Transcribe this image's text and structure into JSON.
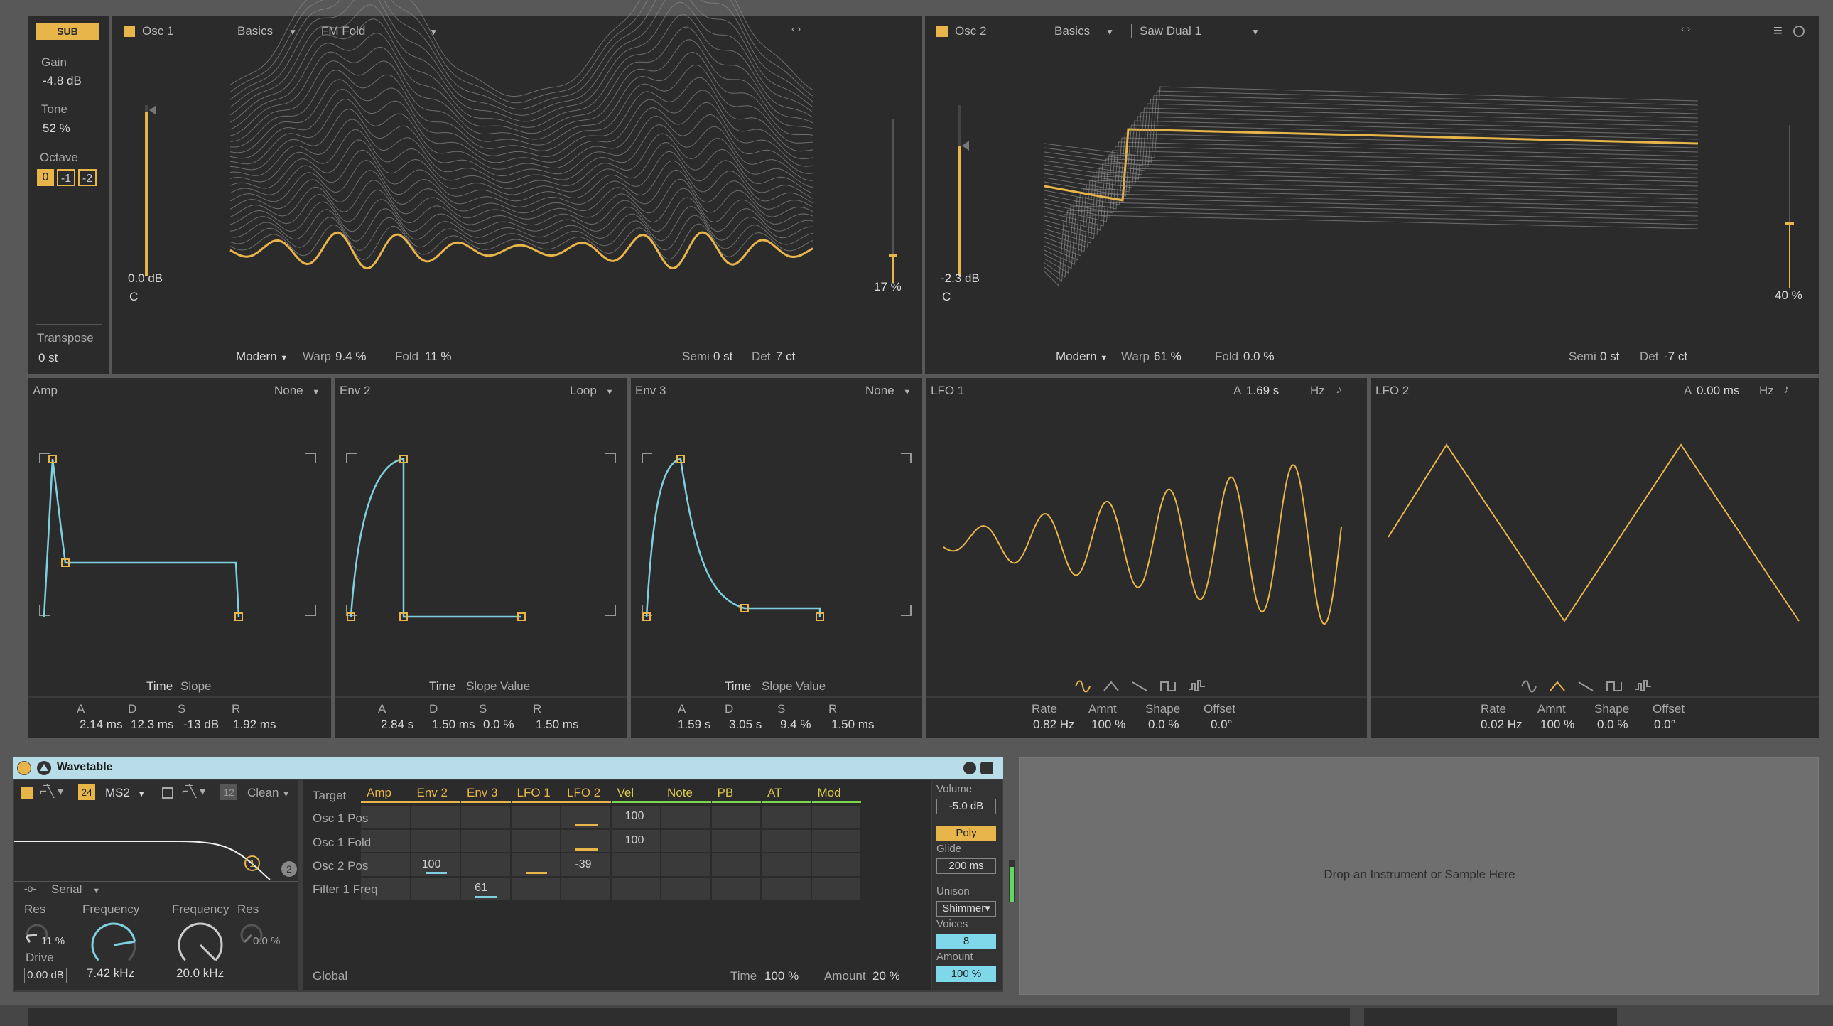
{
  "sub": {
    "label": "SUB",
    "gain_label": "Gain",
    "gain": "-4.8 dB",
    "tone_label": "Tone",
    "tone": "52 %",
    "octave_label": "Octave",
    "octave_options": [
      "0",
      "-1",
      "-2"
    ],
    "transpose_label": "Transpose",
    "transpose": "0 st"
  },
  "osc1": {
    "name": "Osc 1",
    "category": "Basics",
    "wavetable": "FM Fold",
    "level": "0.0 dB",
    "note": "C",
    "pos_percent": "17 %",
    "position": 0.17,
    "mode": "Modern",
    "warp_label": "Warp",
    "warp": "9.4 %",
    "fold_label": "Fold",
    "fold": "11 %",
    "semi_label": "Semi",
    "semi": "0 st",
    "det_label": "Det",
    "det": "7 ct"
  },
  "osc2": {
    "name": "Osc 2",
    "category": "Basics",
    "wavetable": "Saw Dual 1",
    "level": "-2.3 dB",
    "note": "C",
    "pos_percent": "40 %",
    "position": 0.4,
    "mode": "Modern",
    "warp_label": "Warp",
    "warp": "61 %",
    "fold_label": "Fold",
    "fold": "0.0 %",
    "semi_label": "Semi",
    "semi": "0 st",
    "det_label": "Det",
    "det": "-7 ct"
  },
  "envelopes": [
    {
      "name": "Amp",
      "mode": "None",
      "tabs": [
        "Time",
        "Slope"
      ],
      "params": [
        {
          "label": "A",
          "value": "2.14 ms"
        },
        {
          "label": "D",
          "value": "12.3 ms"
        },
        {
          "label": "S",
          "value": "-13 dB"
        },
        {
          "label": "R",
          "value": "1.92 ms"
        }
      ]
    },
    {
      "name": "Env 2",
      "mode": "Loop",
      "tabs": [
        "Time",
        "Slope",
        "Value"
      ],
      "params": [
        {
          "label": "A",
          "value": "2.84 s"
        },
        {
          "label": "D",
          "value": "1.50 ms"
        },
        {
          "label": "S",
          "value": "0.0 %"
        },
        {
          "label": "R",
          "value": "1.50 ms"
        }
      ]
    },
    {
      "name": "Env 3",
      "mode": "None",
      "tabs": [
        "Time",
        "Slope",
        "Value"
      ],
      "params": [
        {
          "label": "A",
          "value": "1.59 s"
        },
        {
          "label": "D",
          "value": "3.05 s"
        },
        {
          "label": "S",
          "value": "9.4 %"
        },
        {
          "label": "R",
          "value": "1.50 ms"
        }
      ]
    }
  ],
  "lfo1": {
    "name": "LFO 1",
    "a_label": "A",
    "attack": "1.69 s",
    "unit": "Hz",
    "rate_label": "Rate",
    "rate": "0.82 Hz",
    "amnt_label": "Amnt",
    "amnt": "100 %",
    "shape_label": "Shape",
    "shape": "0.0 %",
    "offset_label": "Offset",
    "offset": "0.0°"
  },
  "lfo2": {
    "name": "LFO 2",
    "a_label": "A",
    "attack": "0.00 ms",
    "unit": "Hz",
    "rate_label": "Rate",
    "rate": "0.02 Hz",
    "amnt_label": "Amnt",
    "amnt": "100 %",
    "shape_label": "Shape",
    "shape": "0.0 %",
    "offset_label": "Offset",
    "offset": "0.0°"
  },
  "device": {
    "title": "Wavetable",
    "filter_slope": "24",
    "filter_type": "MS2",
    "filter2_slope": "12",
    "filter2_type": "Clean",
    "routing": "Serial",
    "res_label": "Res",
    "res": "11 %",
    "drive_label": "Drive",
    "drive": "0.00 dB",
    "freq_label": "Frequency",
    "freq": "7.42 kHz",
    "freq2_label": "Frequency",
    "freq2": "20.0 kHz",
    "res2_label": "Res",
    "res2": "0.0 %",
    "badge1": "1",
    "badge2": "2"
  },
  "matrix": {
    "target_label": "Target",
    "columns": [
      "Amp",
      "Env 2",
      "Env 3",
      "LFO 1",
      "LFO 2",
      "Vel",
      "Note",
      "PB",
      "AT",
      "Mod"
    ],
    "rows": [
      "Osc 1 Pos",
      "Osc 1 Fold",
      "Osc 2 Pos",
      "Filter 1 Freq"
    ],
    "values": {
      "v1": "100",
      "v2": "100",
      "v3": "100",
      "v4": "-39",
      "v5": "61"
    },
    "global_label": "Global",
    "time_label": "Time",
    "time": "100 %",
    "amount_label": "Amount",
    "amount": "20 %"
  },
  "voice": {
    "volume_label": "Volume",
    "volume": "-5.0 dB",
    "poly": "Poly",
    "glide_label": "Glide",
    "glide": "200 ms",
    "unison_label": "Unison",
    "unison": "Shimmer",
    "voices_label": "Voices",
    "voices": "8",
    "amount_label": "Amount",
    "amount": "100 %"
  },
  "drop_zone": "Drop an Instrument or Sample Here",
  "colors": {
    "accent": "#e8b54a",
    "envelope": "#7fcfe0",
    "panel": "#2b2b2b",
    "background": "#585858"
  }
}
